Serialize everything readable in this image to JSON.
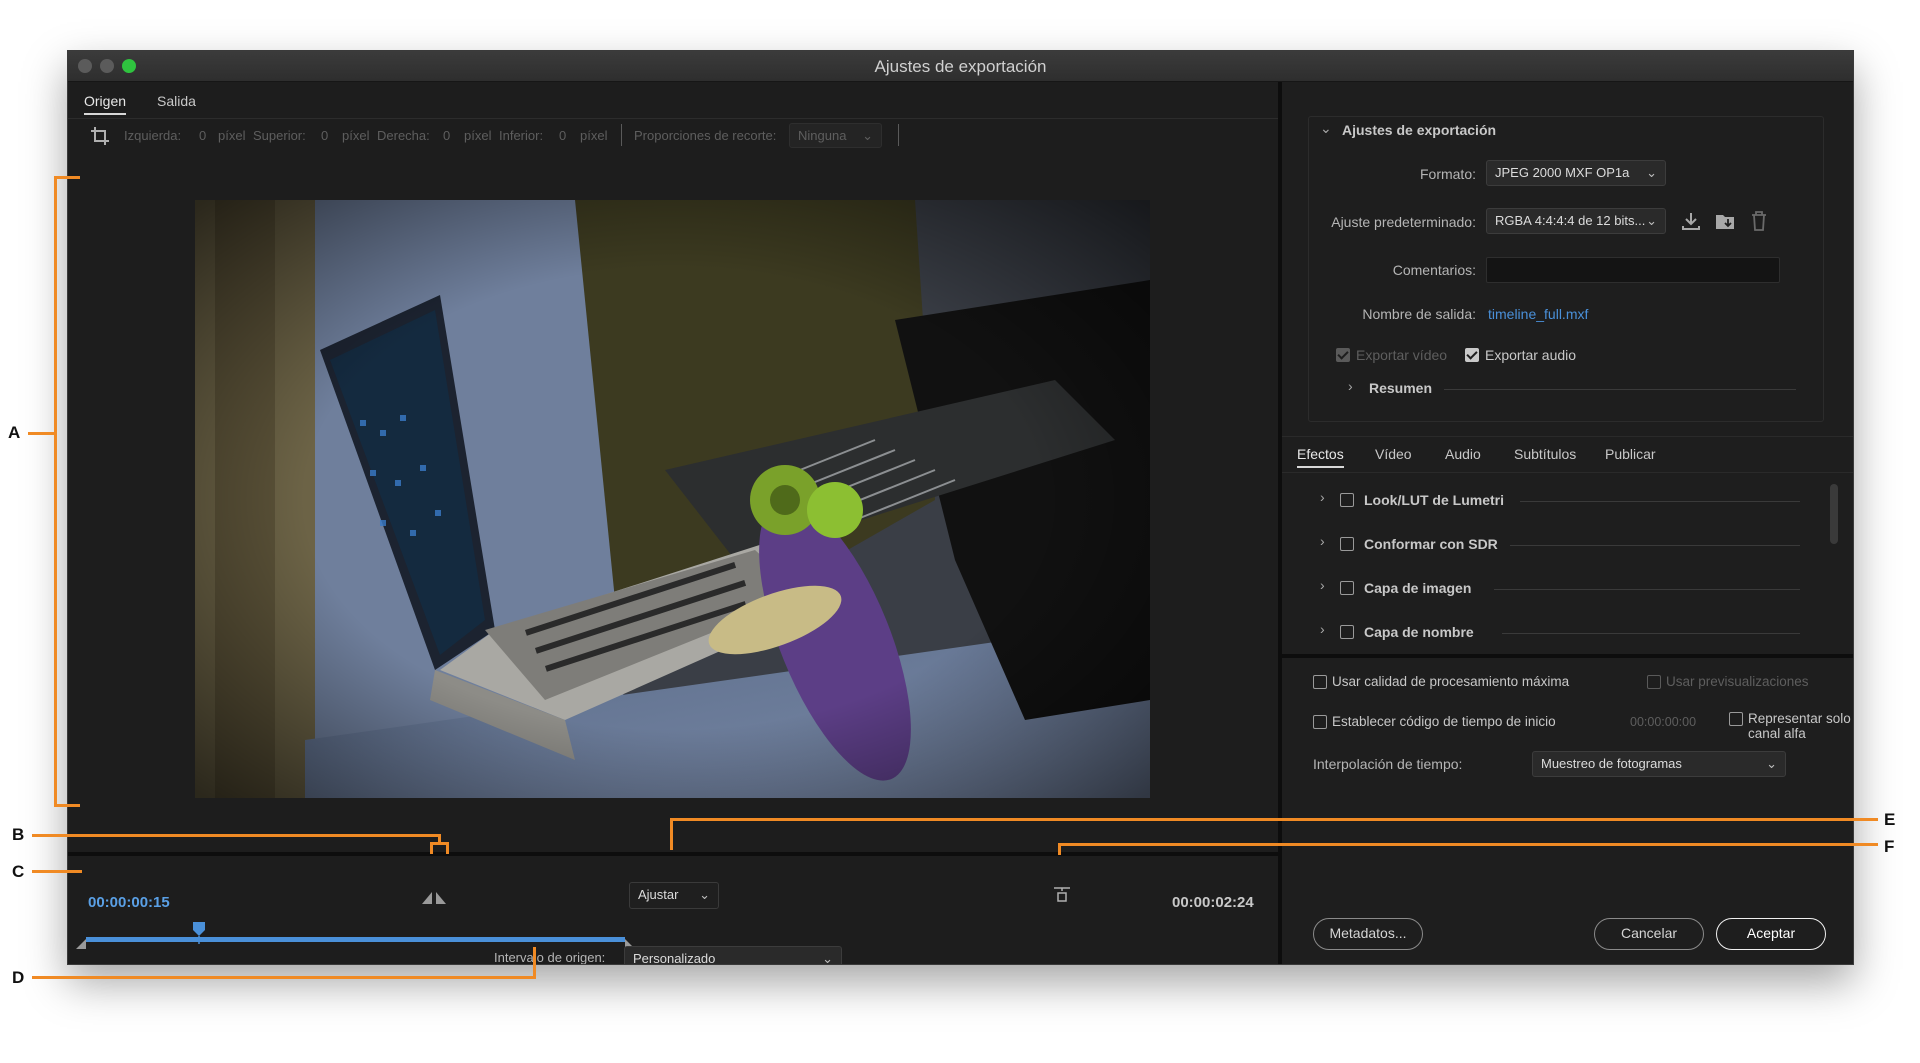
{
  "window": {
    "title": "Ajustes de exportación"
  },
  "source_tabs": [
    {
      "label": "Origen"
    },
    {
      "label": "Salida"
    }
  ],
  "crop": {
    "left_label": "Izquierda:",
    "left_value": "0",
    "left_unit": "píxel",
    "top_label": "Superior:",
    "top_value": "0",
    "top_unit": "píxel",
    "right_label": "Derecha:",
    "right_value": "0",
    "right_unit": "píxel",
    "bottom_label": "Inferior:",
    "bottom_value": "0",
    "bottom_unit": "píxel",
    "ratio_label": "Proporciones de recorte:",
    "ratio_value": "Ninguna"
  },
  "timeline": {
    "current_time": "00:00:00:15",
    "fit_value": "Ajustar",
    "end_time": "00:00:02:24",
    "playhead_position": 0.16,
    "range_end": 0.99,
    "range_label": "Intervalo de origen:",
    "range_value": "Personalizado"
  },
  "export_settings": {
    "header": "Ajustes de exportación",
    "format_label": "Formato:",
    "format_value": "JPEG 2000 MXF OP1a",
    "preset_label": "Ajuste predeterminado:",
    "preset_value": "RGBA 4:4:4:4 de 12 bits...",
    "comments_label": "Comentarios:",
    "comments_value": "",
    "output_label": "Nombre de salida:",
    "output_value": "timeline_full.mxf",
    "export_video_label": "Exportar vídeo",
    "export_audio_label": "Exportar audio",
    "summary_label": "Resumen"
  },
  "effect_tabs": [
    {
      "label": "Efectos"
    },
    {
      "label": "Vídeo"
    },
    {
      "label": "Audio"
    },
    {
      "label": "Subtítulos"
    },
    {
      "label": "Publicar"
    }
  ],
  "effects": [
    {
      "label": "Look/LUT de Lumetri"
    },
    {
      "label": "Conformar con SDR"
    },
    {
      "label": "Capa de imagen"
    },
    {
      "label": "Capa de nombre"
    }
  ],
  "options": {
    "max_quality_label": "Usar calidad de procesamiento máxima",
    "previews_label": "Usar previsualizaciones",
    "start_tc_label": "Establecer código de tiempo de inicio",
    "start_tc_value": "00:00:00:00",
    "alpha_label": "Representar solo canal alfa",
    "interp_label": "Interpolación de tiempo:",
    "interp_value": "Muestreo de fotogramas"
  },
  "buttons": {
    "metadata": "Metadatos...",
    "cancel": "Cancelar",
    "ok": "Aceptar"
  },
  "annotations": {
    "a": "A",
    "b": "B",
    "c": "C",
    "d": "D",
    "e": "E",
    "f": "F"
  },
  "colors": {
    "accent_blue": "#4a90d9",
    "timecode_blue": "#5aa0e6",
    "annotation_orange": "#f08a24"
  }
}
